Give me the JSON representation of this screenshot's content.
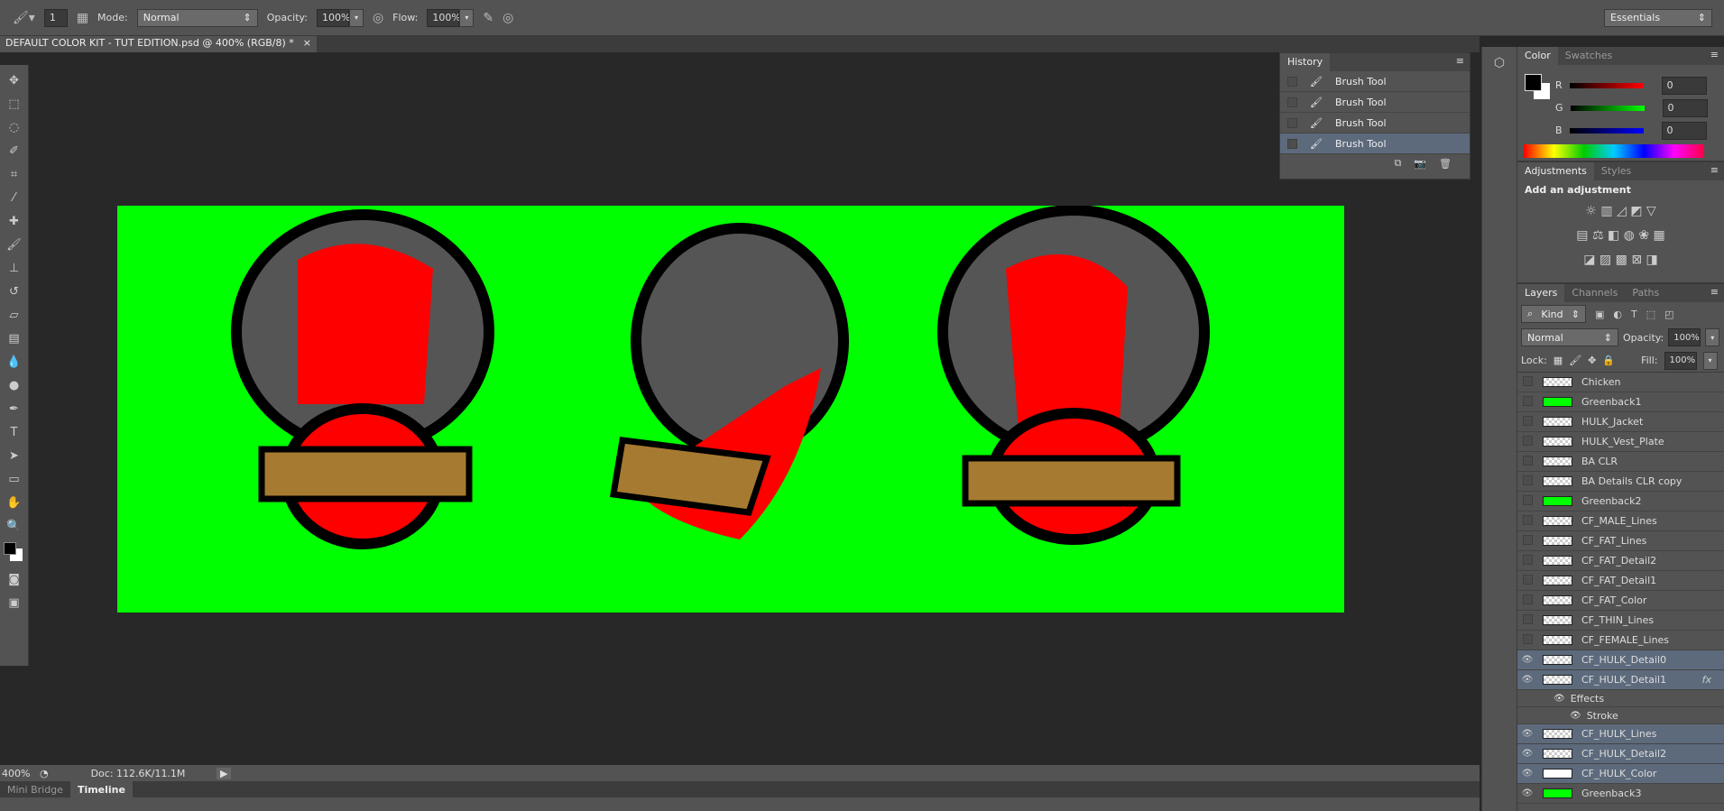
{
  "options_bar": {
    "brush_size": "1",
    "mode_label": "Mode:",
    "mode_value": "Normal",
    "opacity_label": "Opacity:",
    "opacity_value": "100%",
    "flow_label": "Flow:",
    "flow_value": "100%",
    "workspace": "Essentials"
  },
  "document": {
    "tab_title": "DEFAULT COLOR KIT - TUT EDITION.psd @ 400% (RGB/8) *",
    "close": "×",
    "zoom": "400%",
    "doc_size": "Doc: 112.6K/11.1M",
    "canvas_color": "#00ff00"
  },
  "history": {
    "title": "History",
    "items": [
      "Brush Tool",
      "Brush Tool",
      "Brush Tool",
      "Brush Tool"
    ]
  },
  "color": {
    "tabs": [
      "Color",
      "Swatches"
    ],
    "channels": [
      {
        "label": "R",
        "value": "0",
        "color": "#ff0000"
      },
      {
        "label": "G",
        "value": "0",
        "color": "#00ff00"
      },
      {
        "label": "B",
        "value": "0",
        "color": "#0000ff"
      }
    ]
  },
  "adjustments": {
    "tabs": [
      "Adjustments",
      "Styles"
    ],
    "heading": "Add an adjustment"
  },
  "layers": {
    "tabs": [
      "Layers",
      "Channels",
      "Paths"
    ],
    "filter": "Kind",
    "blend": "Normal",
    "opacity_label": "Opacity:",
    "opacity": "100%",
    "lock_label": "Lock:",
    "fill_label": "Fill:",
    "fill": "100%",
    "items": [
      {
        "name": "Chicken",
        "visible": false,
        "selected": false,
        "thumb": "checker"
      },
      {
        "name": "Greenback1",
        "visible": false,
        "selected": false,
        "thumb": "green"
      },
      {
        "name": "HULK_Jacket",
        "visible": false,
        "selected": false,
        "thumb": "checker"
      },
      {
        "name": "HULK_Vest_Plate",
        "visible": false,
        "selected": false,
        "thumb": "checker"
      },
      {
        "name": "BA CLR",
        "visible": false,
        "selected": false,
        "thumb": "checker"
      },
      {
        "name": "BA Details CLR copy",
        "visible": false,
        "selected": false,
        "thumb": "checker"
      },
      {
        "name": "Greenback2",
        "visible": false,
        "selected": false,
        "thumb": "green"
      },
      {
        "name": "CF_MALE_Lines",
        "visible": false,
        "selected": false,
        "thumb": "checker"
      },
      {
        "name": "CF_FAT_Lines",
        "visible": false,
        "selected": false,
        "thumb": "checker"
      },
      {
        "name": "CF_FAT_Detail2",
        "visible": false,
        "selected": false,
        "thumb": "checker"
      },
      {
        "name": "CF_FAT_Detail1",
        "visible": false,
        "selected": false,
        "thumb": "checker"
      },
      {
        "name": "CF_FAT_Color",
        "visible": false,
        "selected": false,
        "thumb": "checker"
      },
      {
        "name": "CF_THIN_Lines",
        "visible": false,
        "selected": false,
        "thumb": "checker"
      },
      {
        "name": "CF_FEMALE_Lines",
        "visible": false,
        "selected": false,
        "thumb": "checker"
      },
      {
        "name": "CF_HULK_Detail0",
        "visible": true,
        "selected": true,
        "thumb": "checker"
      },
      {
        "name": "CF_HULK_Detail1",
        "visible": true,
        "selected": true,
        "thumb": "checker",
        "fx": "fx",
        "effects": [
          "Effects",
          "Stroke"
        ]
      },
      {
        "name": "CF_HULK_Lines",
        "visible": true,
        "selected": true,
        "thumb": "checker"
      },
      {
        "name": "CF_HULK_Detail2",
        "visible": true,
        "selected": true,
        "thumb": "checker"
      },
      {
        "name": "CF_HULK_Color",
        "visible": true,
        "selected": true,
        "thumb": "red"
      },
      {
        "name": "Greenback3",
        "visible": true,
        "selected": false,
        "thumb": "green"
      }
    ]
  },
  "bottom_tabs": [
    "Mini Bridge",
    "Timeline"
  ]
}
